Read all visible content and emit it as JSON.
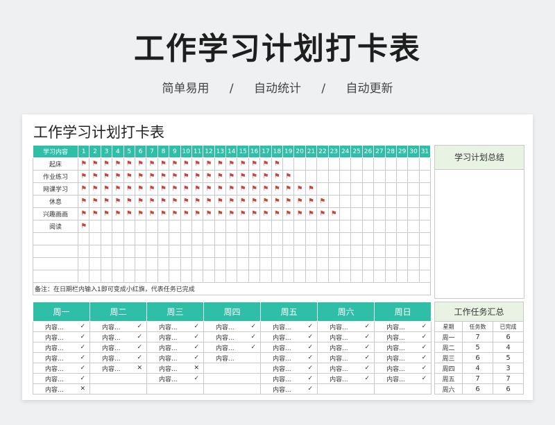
{
  "page": {
    "title": "工作学习计划打卡表",
    "subtitle_items": [
      "简单易用",
      "/",
      "自动统计",
      "/",
      "自动更新"
    ]
  },
  "sheet": {
    "title": "工作学习计划打卡表",
    "checkin_header": "学习内容",
    "days": [
      "1",
      "2",
      "3",
      "4",
      "5",
      "6",
      "7",
      "8",
      "9",
      "10",
      "11",
      "12",
      "13",
      "14",
      "15",
      "16",
      "17",
      "18",
      "19",
      "20",
      "21",
      "22",
      "23",
      "24",
      "25",
      "26",
      "27",
      "28",
      "29",
      "30",
      "31"
    ],
    "flag_glyph": "⚑",
    "rows": [
      {
        "label": "起床",
        "flags": 18
      },
      {
        "label": "作业练习",
        "flags": 19
      },
      {
        "label": "网课学习",
        "flags": 21
      },
      {
        "label": "休息",
        "flags": 22
      },
      {
        "label": "兴趣画画",
        "flags": 23
      },
      {
        "label": "阅读",
        "flags": 1
      },
      {
        "label": "",
        "flags": 0
      },
      {
        "label": "",
        "flags": 0
      },
      {
        "label": "",
        "flags": 0
      },
      {
        "label": "",
        "flags": 0
      }
    ],
    "note": "备注：在日期栏内输入1即可变成小红旗，代表任务已完成",
    "summary_title": "学习计划总结"
  },
  "weekly": {
    "days": [
      "周一",
      "周二",
      "周三",
      "周四",
      "周五",
      "周六",
      "周日"
    ],
    "rows": [
      [
        [
          "内容...",
          "✓"
        ],
        [
          "内容...",
          "✓"
        ],
        [
          "内容...",
          "✓"
        ],
        [
          "内容...",
          "✓"
        ],
        [
          "内容...",
          "✓"
        ],
        [
          "内容...",
          "✓"
        ],
        [
          "内容...",
          "✓"
        ]
      ],
      [
        [
          "内容...",
          "✓"
        ],
        [
          "内容...",
          "✓"
        ],
        [
          "内容...",
          "✓"
        ],
        [
          "内容...",
          "✓"
        ],
        [
          "内容...",
          "✓"
        ],
        [
          "内容...",
          "✓"
        ],
        [
          "内容...",
          "✓"
        ]
      ],
      [
        [
          "内容...",
          "✓"
        ],
        [
          "内容...",
          "✓"
        ],
        [
          "内容...",
          "✓"
        ],
        [
          "内容...",
          "✓"
        ],
        [
          "内容...",
          "✓"
        ],
        [
          "内容...",
          "✓"
        ],
        [
          "内容...",
          "✓"
        ]
      ],
      [
        [
          "内容...",
          "✓"
        ],
        [
          "内容...",
          "✓"
        ],
        [
          "内容...",
          "✓"
        ],
        [
          "内容...",
          ""
        ],
        [
          "内容...",
          "✓"
        ],
        [
          "内容...",
          "✓"
        ],
        [
          "内容...",
          "✓"
        ]
      ],
      [
        [
          "内容...",
          "✓"
        ],
        [
          "内容...",
          "✕"
        ],
        [
          "内容...",
          "✕"
        ],
        [
          "",
          ""
        ],
        [
          "内容...",
          "✓"
        ],
        [
          "内容...",
          "✓"
        ],
        [
          "内容...",
          "✓"
        ]
      ],
      [
        [
          "内容...",
          "✓"
        ],
        [
          "",
          ""
        ],
        [
          "内容...",
          "✓"
        ],
        [
          "",
          ""
        ],
        [
          "内容...",
          "✓"
        ],
        [
          "内容...",
          "✓"
        ],
        [
          "内容...",
          "✓"
        ]
      ],
      [
        [
          "内容...",
          "✕"
        ],
        [
          "",
          ""
        ],
        [
          "",
          ""
        ],
        [
          "",
          ""
        ],
        [
          "内容...",
          "✓"
        ],
        [
          "",
          ""
        ],
        [
          "",
          ""
        ]
      ]
    ]
  },
  "work_summary": {
    "title": "工作任务汇总",
    "columns": [
      "星期",
      "任务数",
      "已完成"
    ],
    "rows": [
      [
        "周一",
        "7",
        "6"
      ],
      [
        "周二",
        "5",
        "4"
      ],
      [
        "周三",
        "6",
        "5"
      ],
      [
        "周四",
        "4",
        "3"
      ],
      [
        "周五",
        "7",
        "7"
      ],
      [
        "周六",
        "6",
        "6"
      ]
    ]
  }
}
